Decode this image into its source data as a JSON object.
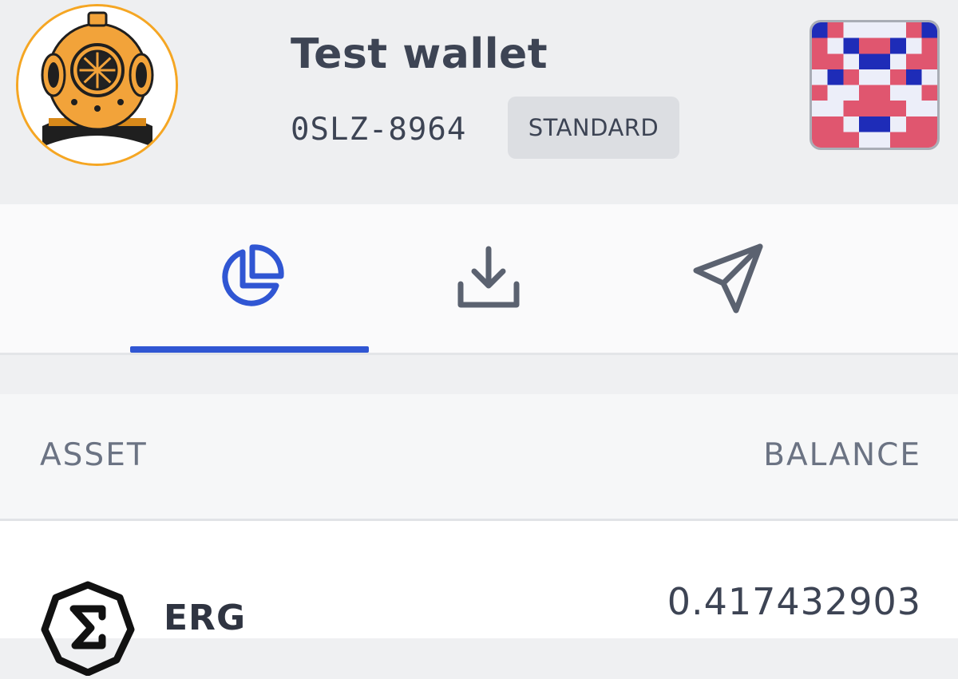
{
  "wallet": {
    "name": "Test wallet",
    "checksum": "0SLZ-8964",
    "type_badge": "STANDARD"
  },
  "nav": {
    "active_tab": "portfolio",
    "accent_color": "#3056d3",
    "tabs": [
      {
        "id": "portfolio",
        "icon": "pie-chart-icon"
      },
      {
        "id": "receive",
        "icon": "download-icon"
      },
      {
        "id": "send",
        "icon": "send-icon"
      }
    ]
  },
  "assets_table": {
    "columns": {
      "asset": "ASSET",
      "balance": "BALANCE"
    },
    "rows": [
      {
        "ticker": "ERG",
        "balance": "0.417432903",
        "icon": "erg-icon"
      }
    ]
  }
}
